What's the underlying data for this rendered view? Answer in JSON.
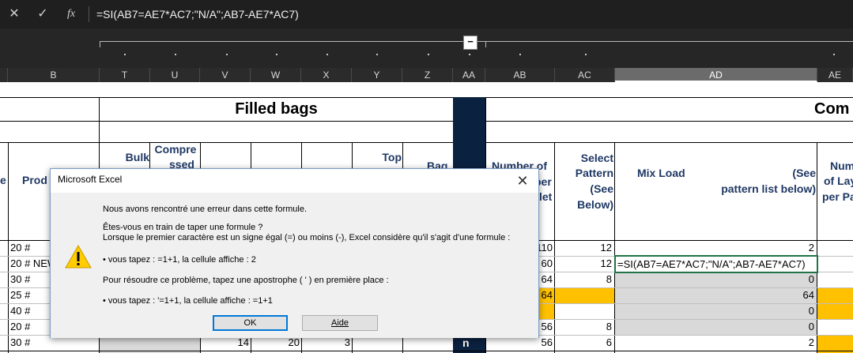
{
  "formula_bar": {
    "cancel_icon": "✕",
    "enter_icon": "✓",
    "fx_label": "fx",
    "formula": "=SI(AB7=AE7*AC7;\"N/A\";AB7-AE7*AC7)"
  },
  "grouping": {
    "collapse_label": "−"
  },
  "columns": [
    "B",
    "T",
    "U",
    "V",
    "W",
    "X",
    "Y",
    "Z",
    "AA",
    "AB",
    "AC",
    "AD",
    "AE"
  ],
  "selected_column": "AD",
  "sheet": {
    "section_filled_bags": "Filled bags",
    "section_com": "Com",
    "headers": {
      "e": "e",
      "prod": "Prod",
      "bulk": "Bulk",
      "compressed_1": "Compre",
      "compressed_2": "ssed",
      "top": "Top",
      "bag": "Bag",
      "number_of": "Number of",
      "per": "per",
      "let": "let",
      "select": "Select",
      "pattern": "Pattern",
      "see": "(See",
      "below": "Below)",
      "mix_load": "Mix Load",
      "see2": "(See",
      "pattern_list": "pattern list below)",
      "num": "Num",
      "of_lay": "of Lay",
      "per_pa": "per Pa"
    },
    "rows": [
      {
        "b": "20 #",
        "ab": "110",
        "ac": "12",
        "ad": "2"
      },
      {
        "b": "20 # NEW",
        "ab": "60",
        "ac": "12",
        "ad": "=SI(AB7=AE7*AC7;\"N/A\";AB7-AE7*AC7)"
      },
      {
        "b": "30 #",
        "ab": "64",
        "ac": "8",
        "ad": "0"
      },
      {
        "b": "25 #",
        "ab": "64",
        "ac": "",
        "ad": "64"
      },
      {
        "b": "40 #",
        "ab": "",
        "ac": "",
        "ad": "0"
      },
      {
        "b": "20 #",
        "ab": "56",
        "ac": "8",
        "ad": "0"
      },
      {
        "b": "30 #",
        "v": "14",
        "w": "20",
        "x": "3",
        "ab": "56",
        "ac": "6",
        "ad": "2"
      }
    ],
    "navy_label": "n"
  },
  "dialog": {
    "title": "Microsoft Excel",
    "close_icon": "✕",
    "line1": "Nous avons rencontré une erreur dans cette formule.",
    "line2": "Êtes-vous en train de taper une formule ?",
    "line3": "Lorsque le premier caractère est un signe égal (=) ou moins (-), Excel considère qu'il s'agit d'une formule :",
    "line4": "• vous tapez :   =1+1, la cellule affiche :   2",
    "line5": "Pour résoudre ce problème, tapez une apostrophe ( ' ) en première place :",
    "line6": "• vous tapez :   '=1+1, la cellule affiche :   =1+1",
    "ok_label": "OK",
    "help_label": "Aide",
    "icon": "warning-icon"
  }
}
